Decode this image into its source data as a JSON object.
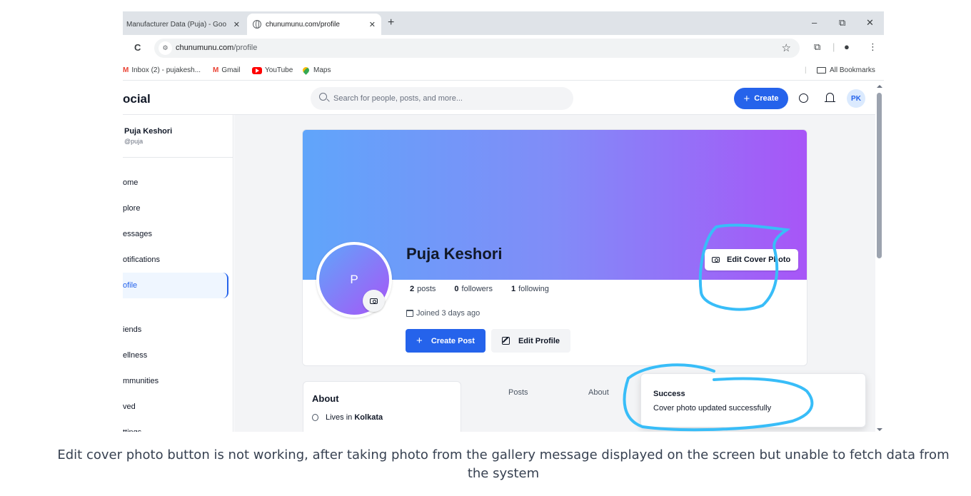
{
  "browser": {
    "tabs": [
      {
        "title": "Manufacturer Data (Puja) - Goo",
        "active": false
      },
      {
        "title": "chunumunu.com/profile",
        "active": true
      }
    ],
    "new_tab": "+",
    "close_glyph": "✕",
    "window_controls": {
      "minimize": "–",
      "restore": "⧉",
      "close": "✕"
    },
    "reload_glyph": "C",
    "url_domain": "chunumunu.com",
    "url_path": "/profile",
    "bookmarks": [
      {
        "icon": "gmail-icon",
        "label": "Inbox (2) - pujakesh..."
      },
      {
        "icon": "gmail-icon",
        "label": "Gmail"
      },
      {
        "icon": "youtube-icon",
        "label": "YouTube"
      },
      {
        "icon": "maps-icon",
        "label": "Maps"
      }
    ],
    "gmail_glyph": "M",
    "all_bookmarks": "All Bookmarks"
  },
  "app": {
    "brand": "ocial",
    "search_placeholder": "Search for people, posts, and more...",
    "create_label": "Create",
    "avatar_initials": "PK",
    "accent": "#2563eb"
  },
  "sidebar": {
    "user_name": "Puja Keshori",
    "user_handle": "@puja",
    "items": [
      {
        "label": "ome",
        "active": false
      },
      {
        "label": "plore",
        "active": false
      },
      {
        "label": "essages",
        "active": false
      },
      {
        "label": "otifications",
        "active": false
      },
      {
        "label": "ofile",
        "active": true
      },
      {
        "label": "iends",
        "active": false
      },
      {
        "label": "ellness",
        "active": false
      },
      {
        "label": "mmunities",
        "active": false
      },
      {
        "label": "ved",
        "active": false
      },
      {
        "label": "ttings",
        "active": false
      }
    ]
  },
  "profile": {
    "name": "Puja Keshori",
    "initial": "P",
    "posts_count": "2",
    "posts_label": "posts",
    "followers_count": "0",
    "followers_label": "followers",
    "following_count": "1",
    "following_label": "following",
    "joined": "Joined 3 days ago",
    "edit_cover_label": "Edit Cover Photo",
    "create_post_label": "Create Post",
    "edit_profile_label": "Edit Profile",
    "cover_gradient": [
      "#60a5fa",
      "#a855f7"
    ]
  },
  "about": {
    "title": "About",
    "lives_in_prefix": "Lives in",
    "city": "Kolkata"
  },
  "profile_tabs": [
    "Posts",
    "About"
  ],
  "toast": {
    "title": "Success",
    "message": "Cover photo updated successfully"
  },
  "caption": "Edit cover photo button is not working, after taking photo from the gallery message displayed on the screen but unable to fetch data from the system",
  "annotation_color": "#38bdf8"
}
